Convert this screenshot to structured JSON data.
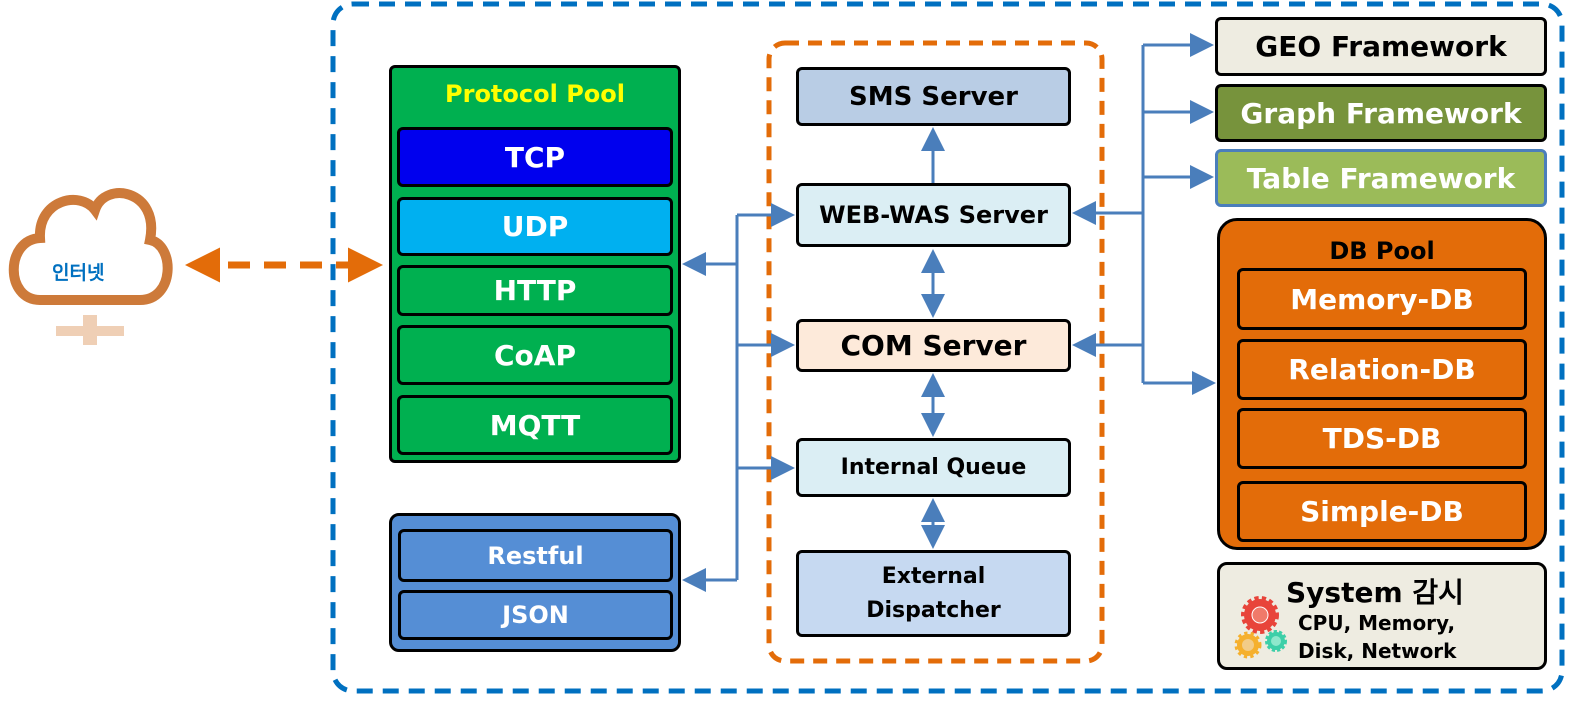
{
  "internet": {
    "label": "인터넷"
  },
  "protocol_pool": {
    "title": "Protocol Pool",
    "items": [
      "TCP",
      "UDP",
      "HTTP",
      "CoAP",
      "MQTT"
    ]
  },
  "api": {
    "items": [
      "Restful",
      "JSON"
    ]
  },
  "servers": {
    "sms": "SMS Server",
    "web": "WEB-WAS Server",
    "com": "COM Server",
    "queue": "Internal Queue",
    "dispatcher": "External Dispatcher"
  },
  "frameworks": [
    "GEO Framework",
    "Graph Framework",
    "Table Framework"
  ],
  "db_pool": {
    "title": "DB Pool",
    "items": [
      "Memory-DB",
      "Relation-DB",
      "TDS-DB",
      "Simple-DB"
    ]
  },
  "system": {
    "title": "System 감시",
    "line1": "CPU, Memory,",
    "line2": "Disk, Network",
    "icon": "gears-icon"
  },
  "colors": {
    "outer": "#0070c0",
    "orange": "#e36c09",
    "arrow": "#4a7ebb",
    "green": "#00b050"
  }
}
